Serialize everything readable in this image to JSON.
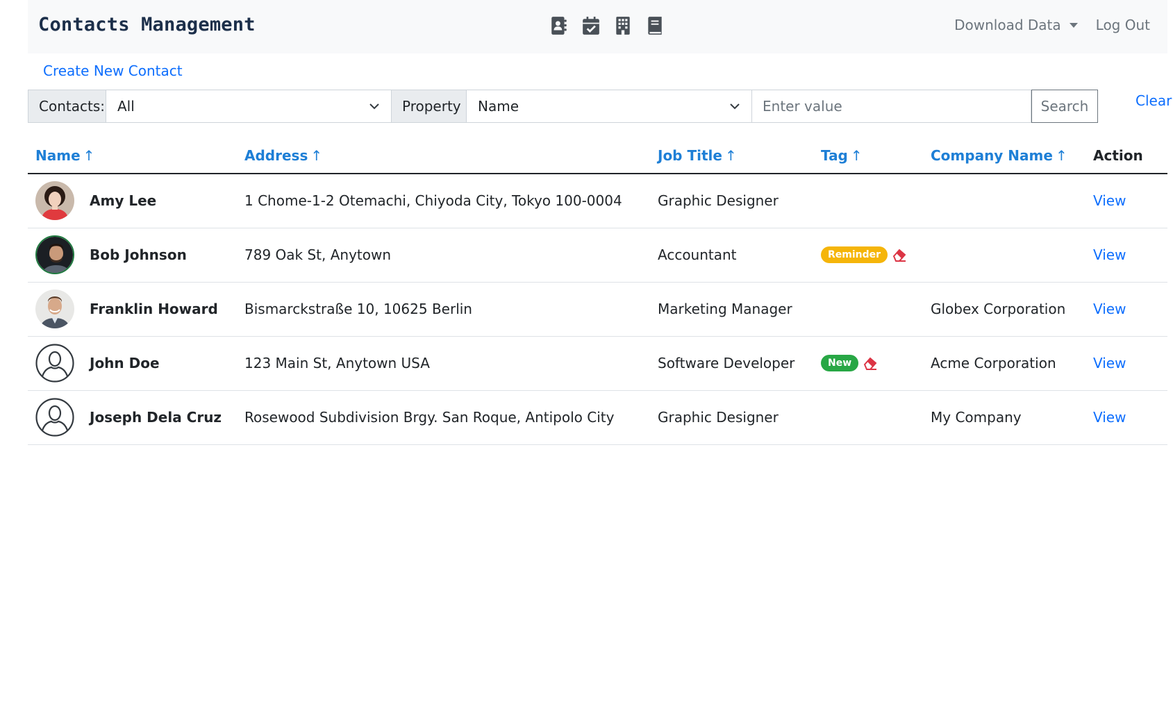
{
  "app": {
    "title": "Contacts Management",
    "nav_icons": [
      "contact-book-icon",
      "calendar-check-icon",
      "building-icon",
      "book-icon"
    ],
    "download_label": "Download Data",
    "logout_label": "Log Out"
  },
  "actions": {
    "create_label": "Create New Contact"
  },
  "filters": {
    "contacts_label": "Contacts:",
    "contacts_value": "All",
    "property_label": "Property",
    "property_value": "Name",
    "value_placeholder": "Enter value",
    "search_label": "Search",
    "clear_label": "Clear"
  },
  "table": {
    "columns": [
      {
        "label": "Name",
        "arrow": "↑"
      },
      {
        "label": "Address",
        "arrow": "↑"
      },
      {
        "label": "Job Title",
        "arrow": "↑"
      },
      {
        "label": "Tag",
        "arrow": "↑"
      },
      {
        "label": "Company Name",
        "arrow": "↑"
      },
      {
        "label": "Action"
      }
    ],
    "rows": [
      {
        "name": "Amy Lee",
        "avatar": "photo-woman",
        "address": "1 Chome-1-2 Otemachi, Chiyoda City, Tokyo 100-0004",
        "job_title": "Graphic Designer",
        "tag": "",
        "company": "",
        "action": "View"
      },
      {
        "name": "Bob Johnson",
        "avatar": "photo-man-beard",
        "address": "789 Oak St, Anytown",
        "job_title": "Accountant",
        "tag": "Reminder",
        "company": "",
        "action": "View"
      },
      {
        "name": "Franklin Howard",
        "avatar": "photo-man-smile",
        "address": "Bismarckstraße 10, 10625 Berlin",
        "job_title": "Marketing Manager",
        "tag": "",
        "company": "Globex Corporation",
        "action": "View"
      },
      {
        "name": "John Doe",
        "avatar": "placeholder-person-icon",
        "address": "123 Main St, Anytown USA",
        "job_title": "Software Developer",
        "tag": "New",
        "company": "Acme Corporation",
        "action": "View"
      },
      {
        "name": "Joseph Dela Cruz",
        "avatar": "placeholder-person-icon",
        "address": "Rosewood Subdivision Brgy. San Roque, Antipolo City",
        "job_title": "Graphic Designer",
        "tag": "",
        "company": "My Company",
        "action": "View"
      }
    ]
  },
  "colors": {
    "link": "#0d6efd",
    "header_link": "#1e7fd6",
    "badge_reminder": "#f5b50a",
    "badge_new": "#28a745",
    "eraser": "#dc3545"
  }
}
